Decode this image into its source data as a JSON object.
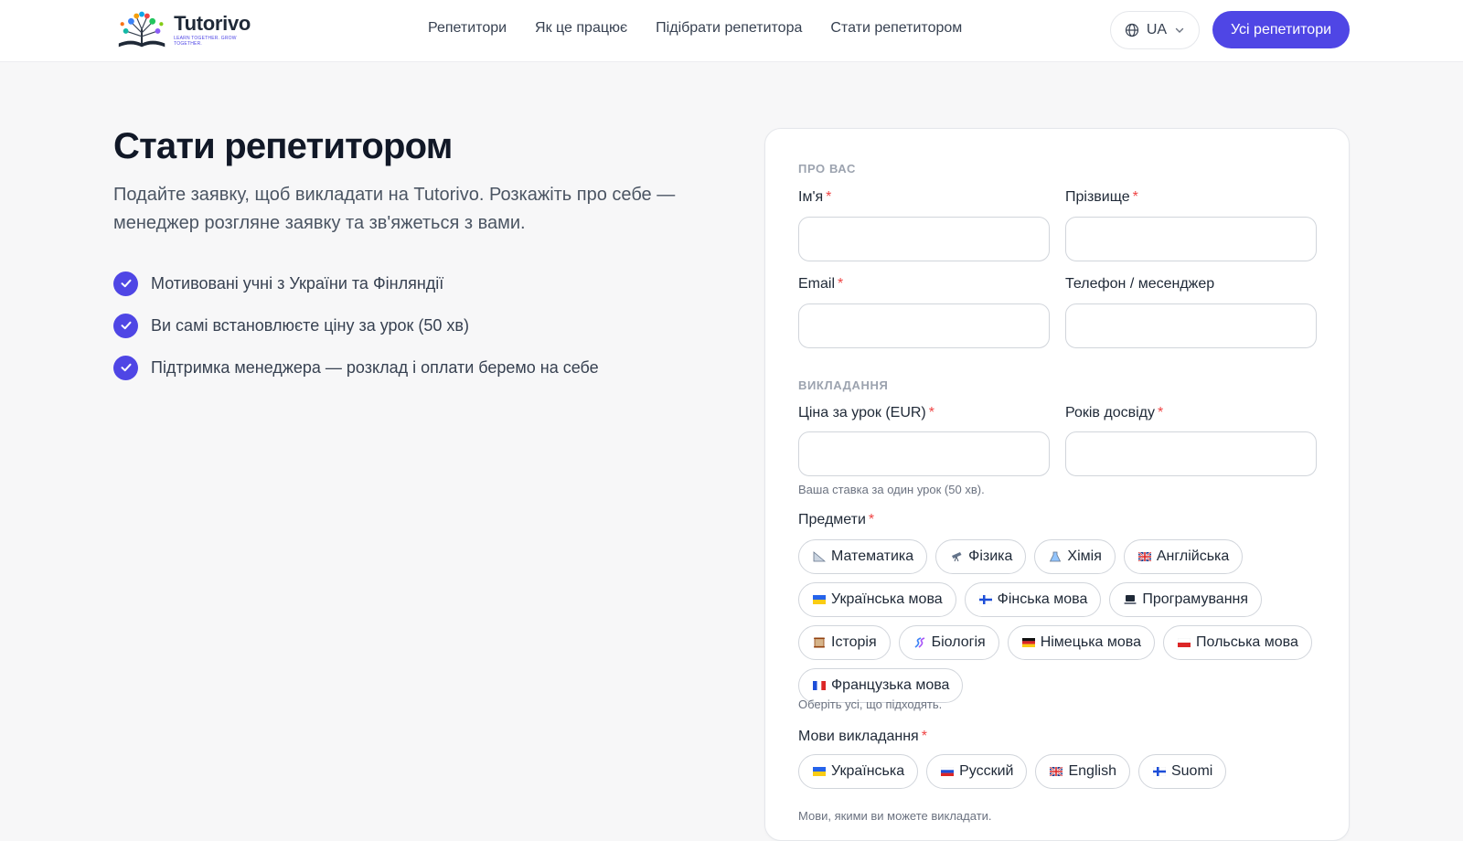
{
  "header": {
    "logo": {
      "name": "Tutorivo",
      "tagline": "LEARN TOGETHER. GROW TOGETHER."
    },
    "nav": [
      "Репетитори",
      "Як це працює",
      "Підібрати репетитора",
      "Стати репетитором"
    ],
    "language": {
      "label": "UA",
      "icon": "globe-icon"
    },
    "cta_label": "Усі репетитори",
    "accent_color": "#4f46e5"
  },
  "hero": {
    "title": "Стати репетитором",
    "subtitle": "Подайте заявку, щоб викладати на Tutorivo. Розкажіть про себе — менеджер розгляне заявку та зв'яжеться з вами.",
    "benefits": [
      "Мотивовані учні з України та Фінляндії",
      "Ви самі встановлюєте ціну за урок (50 хв)",
      "Підтримка менеджера — розклад і оплати беремо на себе"
    ]
  },
  "form": {
    "about": {
      "section_label": "ПРО ВАС",
      "first_name": {
        "label": "Ім'я",
        "required": "*",
        "value": ""
      },
      "last_name": {
        "label": "Прізвище",
        "required": "*",
        "value": ""
      },
      "email": {
        "label": "Email",
        "required": "*",
        "value": ""
      },
      "phone": {
        "label": "Телефон / месенджер",
        "value": ""
      }
    },
    "teaching": {
      "section_label": "ВИКЛАДАННЯ",
      "price": {
        "label": "Ціна за урок (EUR)",
        "required": "*",
        "value": "",
        "hint": "Ваша ставка за один урок (50 хв)."
      },
      "experience": {
        "label": "Років досвіду",
        "required": "*",
        "value": ""
      },
      "subjects": {
        "label": "Предмети",
        "required": "*",
        "hint": "Оберіть усі, що підходять.",
        "items": [
          {
            "icon": "triangle-ruler-icon",
            "label": "Математика"
          },
          {
            "icon": "telescope-icon",
            "label": "Фізика"
          },
          {
            "icon": "flask-icon",
            "label": "Хімія"
          },
          {
            "icon": "uk-flag-icon",
            "label": "Англійська"
          },
          {
            "icon": "ukraine-flag-icon",
            "label": "Українська мова"
          },
          {
            "icon": "finland-flag-icon",
            "label": "Фінська мова"
          },
          {
            "icon": "laptop-icon",
            "label": "Програмування"
          },
          {
            "icon": "scroll-icon",
            "label": "Історія"
          },
          {
            "icon": "dna-icon",
            "label": "Біологія"
          },
          {
            "icon": "germany-flag-icon",
            "label": "Німецька мова"
          },
          {
            "icon": "poland-flag-icon",
            "label": "Польська мова"
          },
          {
            "icon": "france-flag-icon",
            "label": "Французька мова"
          }
        ]
      },
      "languages": {
        "label": "Мови викладання",
        "required": "*",
        "hint": "Мови, якими ви можете викладати.",
        "items": [
          {
            "icon": "ukraine-flag-icon",
            "label": "Українська"
          },
          {
            "icon": "russia-flag-icon",
            "label": "Русский"
          },
          {
            "icon": "uk-flag-icon",
            "label": "English"
          },
          {
            "icon": "finland-flag-icon",
            "label": "Suomi"
          }
        ]
      }
    }
  }
}
